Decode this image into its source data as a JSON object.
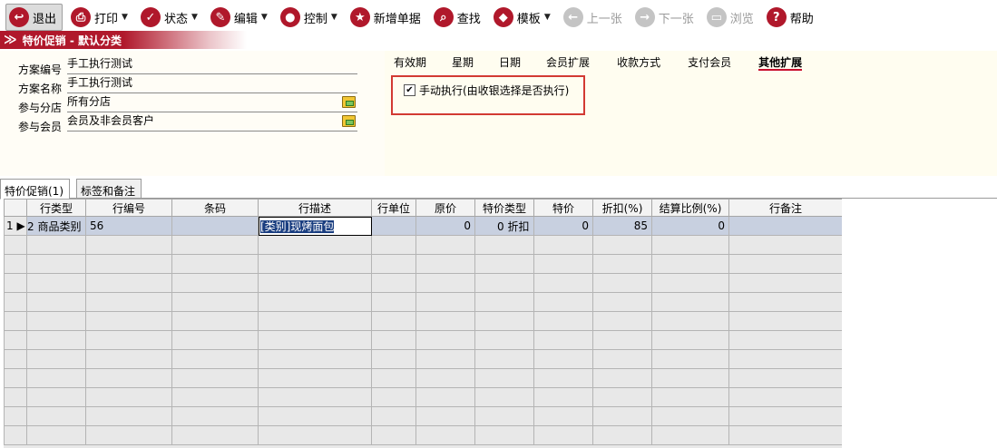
{
  "toolbar": {
    "items": [
      {
        "label": "退出",
        "icon": "exit-icon",
        "glyph": "↩",
        "dropdown": false,
        "enabled": true
      },
      {
        "label": "打印",
        "icon": "print-icon",
        "glyph": "⎙",
        "dropdown": true,
        "enabled": true
      },
      {
        "label": "状态",
        "icon": "check-icon",
        "glyph": "✓",
        "dropdown": true,
        "enabled": true
      },
      {
        "label": "编辑",
        "icon": "pencil-icon",
        "glyph": "✎",
        "dropdown": true,
        "enabled": true
      },
      {
        "label": "控制",
        "icon": "users-icon",
        "glyph": "●",
        "dropdown": true,
        "enabled": true
      },
      {
        "label": "新增单据",
        "icon": "star-icon",
        "glyph": "★",
        "dropdown": false,
        "enabled": true
      },
      {
        "label": "查找",
        "icon": "search-icon",
        "glyph": "⌕",
        "dropdown": false,
        "enabled": true
      },
      {
        "label": "模板",
        "icon": "eraser-icon",
        "glyph": "◆",
        "dropdown": true,
        "enabled": true
      },
      {
        "label": "上一张",
        "icon": "arrow-left-icon",
        "glyph": "←",
        "dropdown": false,
        "enabled": false
      },
      {
        "label": "下一张",
        "icon": "arrow-right-icon",
        "glyph": "→",
        "dropdown": false,
        "enabled": false
      },
      {
        "label": "浏览",
        "icon": "folder-icon",
        "glyph": "▭",
        "dropdown": false,
        "enabled": false
      },
      {
        "label": "帮助",
        "icon": "help-icon",
        "glyph": "?",
        "dropdown": false,
        "enabled": true
      }
    ]
  },
  "title": "特价促销 - 默认分类",
  "form": {
    "code_label": "方案编号",
    "code_value": "手工执行测试",
    "name_label": "方案名称",
    "name_value": "手工执行测试",
    "store_label": "参与分店",
    "store_value": "所有分店",
    "member_label": "参与会员",
    "member_value": "会员及非会员客户"
  },
  "right_tabs": [
    "有效期",
    "星期",
    "日期",
    "会员扩展",
    "收款方式",
    "支付会员",
    "其他扩展"
  ],
  "active_right_tab": "其他扩展",
  "manual_exec": {
    "label": "手动执行(由收银选择是否执行)",
    "checked": true
  },
  "lower_tabs": {
    "active": "特价促销(1)",
    "other": "标签和备注"
  },
  "grid": {
    "columns": [
      "行类型",
      "行编号",
      "条码",
      "行描述",
      "行单位",
      "原价",
      "特价类型",
      "特价",
      "折扣(%)",
      "结算比例(%)",
      "行备注"
    ],
    "row": {
      "index": "1",
      "type": "2 商品类别",
      "line_no": "56",
      "barcode": "",
      "desc": "[类别]现烤面包",
      "unit": "",
      "orig_price": "0",
      "price_type": "0 折扣",
      "special_price": "0",
      "discount": "85",
      "settle_ratio": "0",
      "remark": ""
    }
  },
  "colors": {
    "accent": "#b0182b",
    "highlight_box": "#d23a33",
    "tab_underline": "#c8102e"
  }
}
